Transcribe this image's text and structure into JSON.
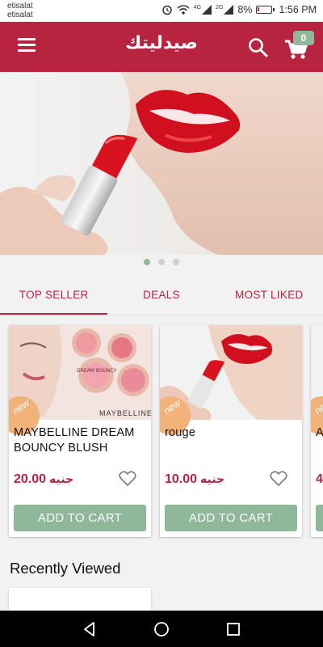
{
  "status_bar": {
    "carrier_1": "etisalat",
    "carrier_2": "etisalat",
    "net1": "4G",
    "net2": "2G",
    "battery": "8%",
    "time": "1:56 PM"
  },
  "app_bar": {
    "title": "صيدليتك",
    "cart_count": "0",
    "color": "#b8233f"
  },
  "banner": {
    "dots": 3,
    "active_dot": 0
  },
  "tabs": [
    {
      "label": "TOP SELLER",
      "active": true
    },
    {
      "label": "DEALS",
      "active": false
    },
    {
      "label": "MOST LIKED",
      "active": false
    }
  ],
  "products": [
    {
      "badge": "new",
      "name": "MAYBELLINE DREAM BOUNCY BLUSH",
      "price": "20.00",
      "currency": "جنيه",
      "button": "ADD TO CART",
      "image_text": "MAYBELLINE",
      "image_text_2": "DREAM BOUNCY"
    },
    {
      "badge": "new",
      "name": "rouge",
      "price": "10.00",
      "currency": "جنيه",
      "button": "ADD TO CART"
    },
    {
      "badge": "new",
      "name": "A",
      "price": "4",
      "currency": "",
      "button": ""
    }
  ],
  "recent": {
    "title": "Recently Viewed"
  },
  "colors": {
    "primary": "#b8233f",
    "accent_green": "#8fb79a",
    "badge_orange": "#f2b27a"
  }
}
